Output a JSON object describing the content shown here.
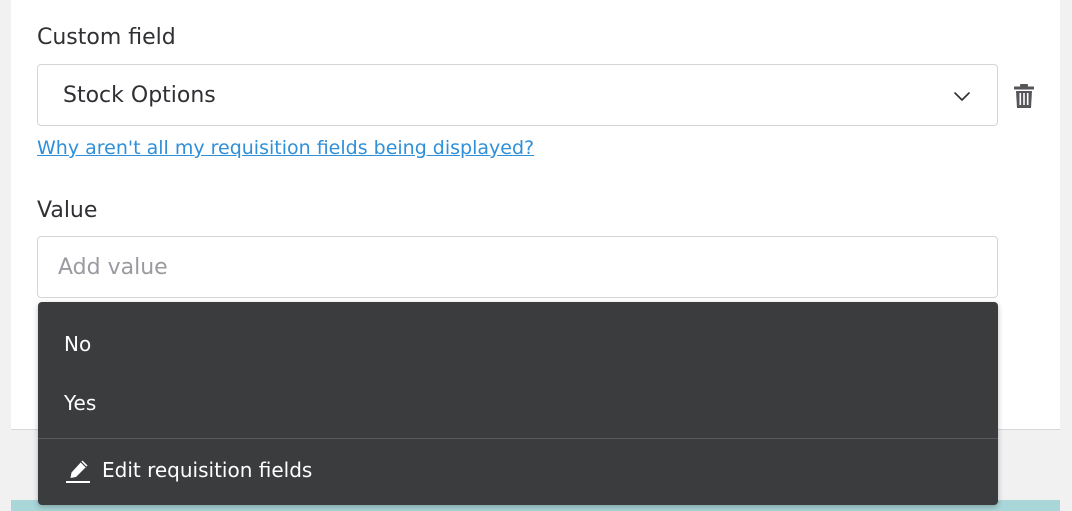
{
  "custom_field": {
    "label": "Custom field",
    "selected_value": "Stock Options",
    "chevron_icon": "chevron-down-icon",
    "delete_icon": "trash-icon"
  },
  "help_link": {
    "text": "Why aren't all my requisition fields being displayed?"
  },
  "value_field": {
    "label": "Value",
    "value": "",
    "placeholder": "Add value"
  },
  "dropdown": {
    "options": [
      {
        "label": "No"
      },
      {
        "label": "Yes"
      }
    ],
    "edit_action": {
      "label": "Edit requisition fields",
      "icon": "pencil-icon"
    }
  },
  "colors": {
    "link": "#2f8fd8",
    "dropdown_bg": "#3b3c3e",
    "footer_strip": "#a9d6d9"
  }
}
